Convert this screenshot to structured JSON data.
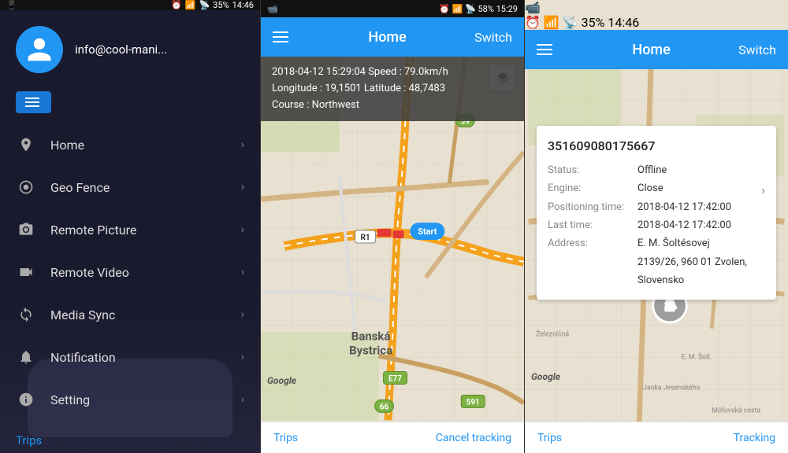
{
  "panel1": {
    "statusBar": {
      "left": "📱",
      "battery": "35%",
      "time": "14:46",
      "icons": [
        "⏰",
        "📶",
        "📡"
      ]
    },
    "profile": {
      "email": "info@cool-mani..."
    },
    "nav": [
      {
        "id": "home",
        "icon": "📍",
        "label": "Home"
      },
      {
        "id": "geofence",
        "icon": "⚙️",
        "label": "Geo Fence"
      },
      {
        "id": "remotepicture",
        "icon": "📷",
        "label": "Remote Picture"
      },
      {
        "id": "remotevideo",
        "icon": "🎥",
        "label": "Remote Video"
      },
      {
        "id": "mediasync",
        "icon": "🔄",
        "label": "Media Sync"
      },
      {
        "id": "notification",
        "icon": "🔔",
        "label": "Notification"
      },
      {
        "id": "setting",
        "icon": "ℹ️",
        "label": "Setting"
      }
    ],
    "tripsLink": "Trips"
  },
  "panel2": {
    "statusBar": {
      "battery": "58%",
      "time": "15:29"
    },
    "header": {
      "title": "Home",
      "switchLabel": "Switch"
    },
    "tripInfo": {
      "line1": "2018-04-12 15:29:04  Speed : 79.0km/h",
      "line2": "Longitude : 19,1501  Latitude : 48,7483",
      "line3": "Course : Northwest"
    },
    "cityLabel": "Banská\nBystrica",
    "googleLabel": "Google",
    "footer": {
      "trips": "Trips",
      "cancelTracking": "Cancel tracking"
    },
    "startMarker": "Start",
    "roads": {
      "e77": "E77",
      "r1": "R1",
      "num59": "59",
      "num66": "66",
      "num591": "591"
    }
  },
  "panel3": {
    "statusBar": {
      "battery": "35%",
      "time": "14:46"
    },
    "header": {
      "title": "Home",
      "switchLabel": "Switch"
    },
    "vehicle": {
      "id": "351609080175667",
      "status": "Offline",
      "engine": "Close",
      "positioningTime": "2018-04-12 17:42:00",
      "lastTime": "2018-04-12 17:42:00",
      "address": "E. M. Šoltésovej\n2139/26, 960 01 Zvolen, Slovensko"
    },
    "googleLabel": "Google",
    "footer": {
      "trips": "Trips",
      "tracking": "Tracking"
    },
    "labels": {
      "status": "Status: ",
      "engine": "Engine: ",
      "positioningTime": "Positioning time: ",
      "lastTime": "Last time: ",
      "address": "Address: "
    }
  }
}
